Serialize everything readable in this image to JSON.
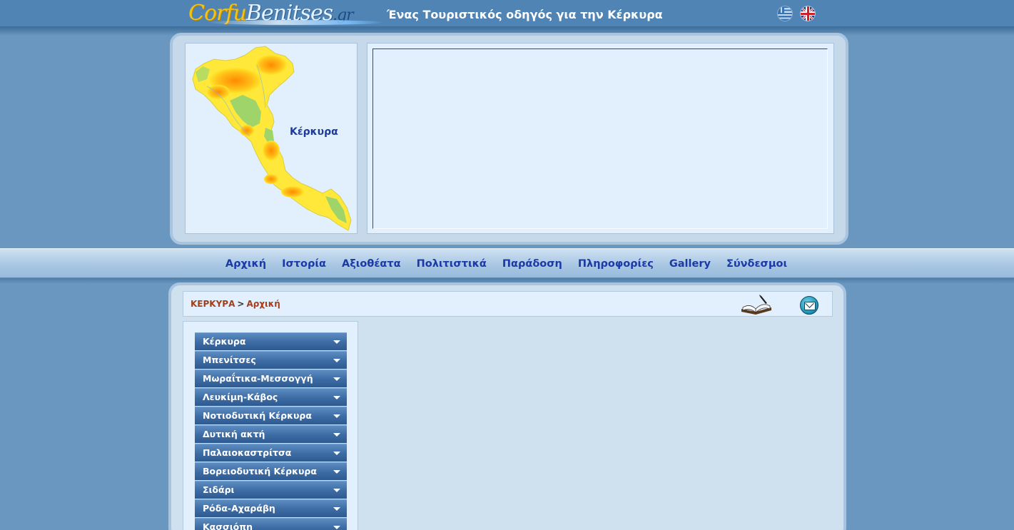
{
  "header": {
    "logo_corfu": "Corfu",
    "logo_benitses": "Benitses",
    "logo_gr": ".gr",
    "tagline": "Ένας Τουριστικός οδηγός για την Κέρκυρα",
    "languages": [
      "greek-flag-icon",
      "uk-flag-icon"
    ]
  },
  "map": {
    "label": "Κέρκυρα"
  },
  "nav": {
    "items": [
      "Αρχική",
      "Ιστορία",
      "Αξιοθέατα",
      "Πολιτιστικά",
      "Παράδοση",
      "Πληροφορίες",
      "Gallery",
      "Σύνδεσμοι"
    ]
  },
  "breadcrumb": {
    "root": "ΚΕΡΚΥΡΑ",
    "separator": ">",
    "current": "Αρχική"
  },
  "sidebar": {
    "items": [
      {
        "label": "Κέρκυρα"
      },
      {
        "label": "Μπενίτσες"
      },
      {
        "label": "Μωραΐτικα-Μεσσογγή"
      },
      {
        "label": "Λευκίμη-Κάβος"
      },
      {
        "label": "Νοτιοδυτική Κέρκυρα"
      },
      {
        "label": "Δυτική ακτή"
      },
      {
        "label": "Παλαιοκαστρίτσα"
      },
      {
        "label": "Βορειοδυτική Κέρκυρα"
      },
      {
        "label": "Σιδάρι"
      },
      {
        "label": "Ρόδα-Αχαράβη"
      },
      {
        "label": "Κασσιόπη"
      }
    ]
  },
  "colors": {
    "page_bg": "#6a97bf",
    "nav_text": "#1b3aa6",
    "breadcrumb_text": "#a53d1a",
    "menu_bg": "#3c6ba3"
  }
}
